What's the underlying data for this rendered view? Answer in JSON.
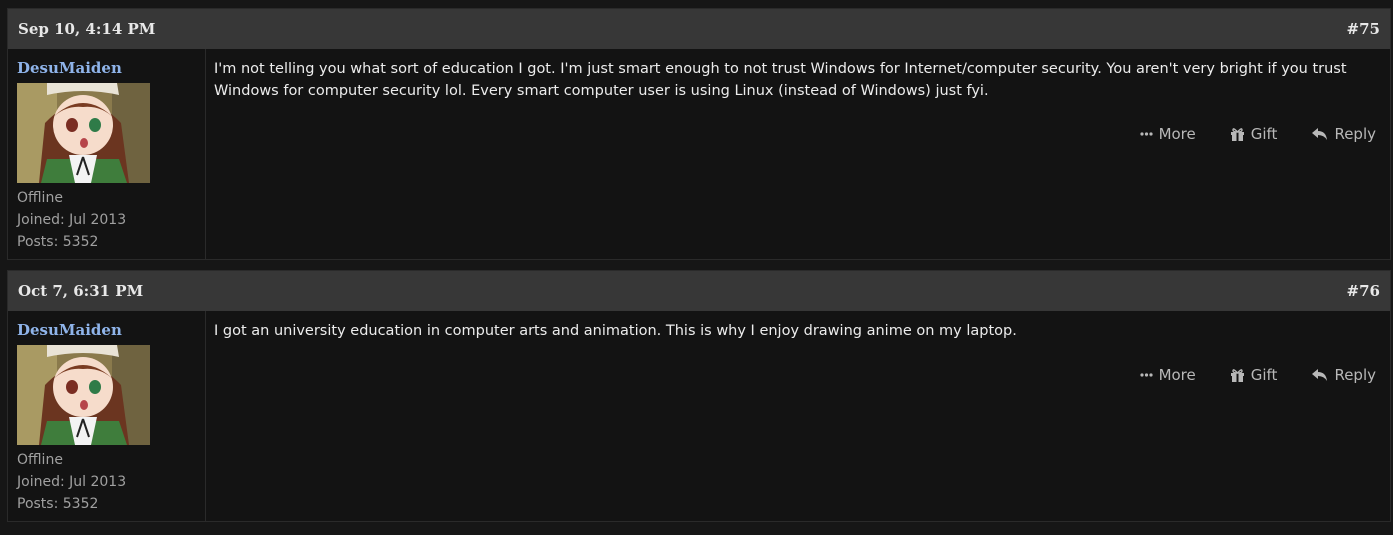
{
  "posts": [
    {
      "date": "Sep 10, 4:14 PM",
      "number": "#75",
      "author": {
        "name": "DesuMaiden",
        "status": "Offline",
        "joined": "Joined: Jul 2013",
        "posts": "Posts: 5352"
      },
      "message": "I'm not telling you what sort of education I got. I'm just smart enough to not trust Windows for Internet/computer security. You aren't very bright if you trust Windows for computer security lol. Every smart computer user is using Linux (instead of Windows) just fyi.",
      "actions": {
        "more": "More",
        "gift": "Gift",
        "reply": "Reply"
      }
    },
    {
      "date": "Oct 7, 6:31 PM",
      "number": "#76",
      "author": {
        "name": "DesuMaiden",
        "status": "Offline",
        "joined": "Joined: Jul 2013",
        "posts": "Posts: 5352"
      },
      "message": "I got an university education in computer arts and animation. This is why I enjoy drawing anime on my laptop.",
      "actions": {
        "more": "More",
        "gift": "Gift",
        "reply": "Reply"
      }
    }
  ],
  "icons": {
    "more": "ellipsis-icon",
    "gift": "gift-icon",
    "reply": "reply-icon"
  },
  "colors": {
    "username": "#8fb4ea",
    "header_bg": "#373737",
    "post_bg": "#131313"
  }
}
